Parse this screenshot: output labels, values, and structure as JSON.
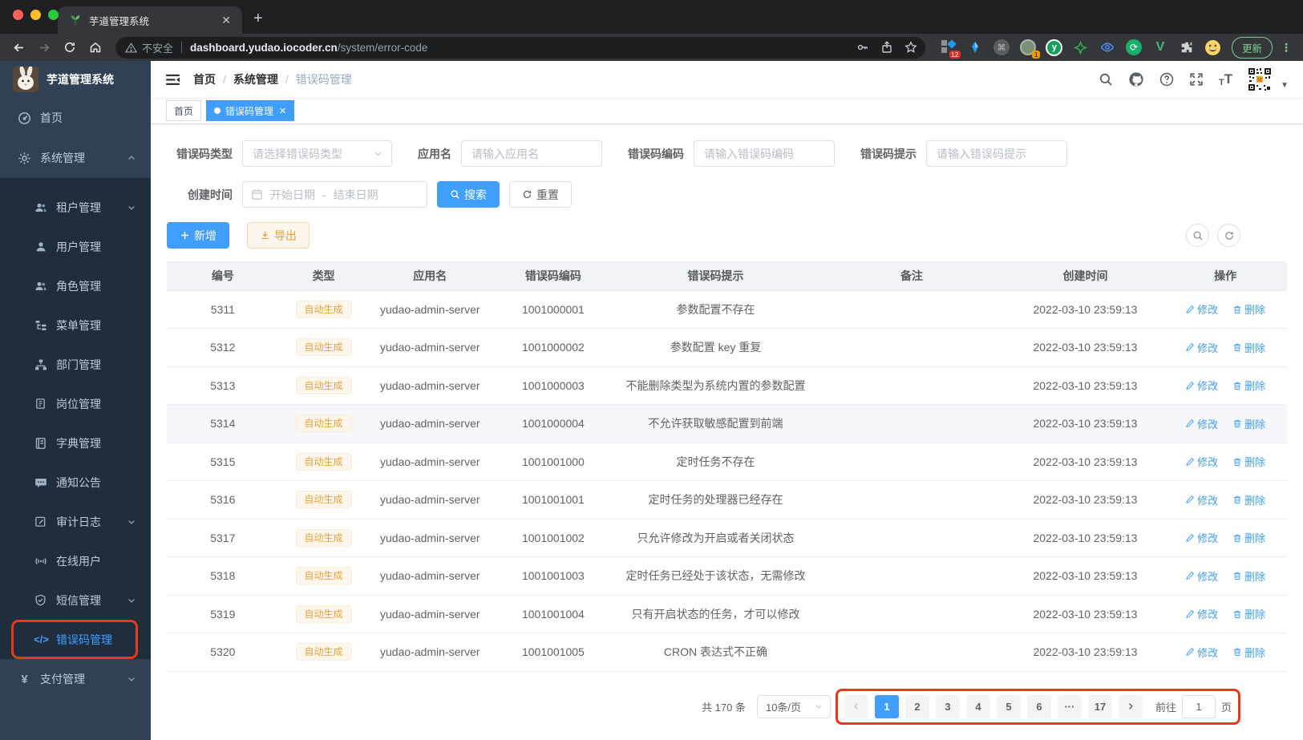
{
  "browser": {
    "tab_title": "芋道管理系统",
    "url": {
      "security_text": "不安全",
      "host": "dashboard.yudao.iocoder.cn",
      "path": "/system/error-code"
    },
    "extensions": {
      "grid_badge": "12",
      "olive_badge": "1",
      "vue_letter": "V",
      "y_letter": "y",
      "update_label": "更新"
    }
  },
  "app_title": "芋道管理系统",
  "breadcrumb": [
    "首页",
    "系统管理",
    "错误码管理"
  ],
  "tags": [
    {
      "label": "首页"
    },
    {
      "label": "错误码管理"
    }
  ],
  "sidebar": {
    "items": [
      {
        "label": "首页"
      },
      {
        "label": "系统管理"
      },
      {
        "label": "租户管理"
      },
      {
        "label": "用户管理"
      },
      {
        "label": "角色管理"
      },
      {
        "label": "菜单管理"
      },
      {
        "label": "部门管理"
      },
      {
        "label": "岗位管理"
      },
      {
        "label": "字典管理"
      },
      {
        "label": "通知公告"
      },
      {
        "label": "审计日志"
      },
      {
        "label": "在线用户"
      },
      {
        "label": "短信管理"
      },
      {
        "label": "错误码管理"
      },
      {
        "label": "支付管理"
      }
    ]
  },
  "filters": {
    "type": {
      "label": "错误码类型",
      "placeholder": "请选择错误码类型"
    },
    "app_name": {
      "label": "应用名",
      "placeholder": "请输入应用名"
    },
    "code": {
      "label": "错误码编码",
      "placeholder": "请输入错误码编码"
    },
    "message": {
      "label": "错误码提示",
      "placeholder": "请输入错误码提示"
    },
    "create_time": {
      "label": "创建时间",
      "start_placeholder": "开始日期",
      "separator": "-",
      "end_placeholder": "结束日期"
    },
    "search_label": "搜索",
    "reset_label": "重置"
  },
  "toolbar": {
    "add_label": "新增",
    "export_label": "导出"
  },
  "table": {
    "headers": [
      "编号",
      "类型",
      "应用名",
      "错误码编码",
      "错误码提示",
      "备注",
      "创建时间",
      "操作"
    ],
    "edit_label": "修改",
    "delete_label": "删除",
    "rows": [
      {
        "id": "5311",
        "type": "自动生成",
        "app": "yudao-admin-server",
        "code": "1001000001",
        "message": "参数配置不存在",
        "remark": "",
        "time": "2022-03-10 23:59:13"
      },
      {
        "id": "5312",
        "type": "自动生成",
        "app": "yudao-admin-server",
        "code": "1001000002",
        "message": "参数配置 key 重复",
        "remark": "",
        "time": "2022-03-10 23:59:13"
      },
      {
        "id": "5313",
        "type": "自动生成",
        "app": "yudao-admin-server",
        "code": "1001000003",
        "message": "不能删除类型为系统内置的参数配置",
        "remark": "",
        "time": "2022-03-10 23:59:13"
      },
      {
        "id": "5314",
        "type": "自动生成",
        "app": "yudao-admin-server",
        "code": "1001000004",
        "message": "不允许获取敏感配置到前端",
        "remark": "",
        "time": "2022-03-10 23:59:13",
        "highlight": true
      },
      {
        "id": "5315",
        "type": "自动生成",
        "app": "yudao-admin-server",
        "code": "1001001000",
        "message": "定时任务不存在",
        "remark": "",
        "time": "2022-03-10 23:59:13"
      },
      {
        "id": "5316",
        "type": "自动生成",
        "app": "yudao-admin-server",
        "code": "1001001001",
        "message": "定时任务的处理器已经存在",
        "remark": "",
        "time": "2022-03-10 23:59:13"
      },
      {
        "id": "5317",
        "type": "自动生成",
        "app": "yudao-admin-server",
        "code": "1001001002",
        "message": "只允许修改为开启或者关闭状态",
        "remark": "",
        "time": "2022-03-10 23:59:13"
      },
      {
        "id": "5318",
        "type": "自动生成",
        "app": "yudao-admin-server",
        "code": "1001001003",
        "message": "定时任务已经处于该状态，无需修改",
        "remark": "",
        "time": "2022-03-10 23:59:13"
      },
      {
        "id": "5319",
        "type": "自动生成",
        "app": "yudao-admin-server",
        "code": "1001001004",
        "message": "只有开启状态的任务，才可以修改",
        "remark": "",
        "time": "2022-03-10 23:59:13"
      },
      {
        "id": "5320",
        "type": "自动生成",
        "app": "yudao-admin-server",
        "code": "1001001005",
        "message": "CRON 表达式不正确",
        "remark": "",
        "time": "2022-03-10 23:59:13"
      }
    ]
  },
  "pagination": {
    "total_text": "共 170 条",
    "page_size_label": "10条/页",
    "pages": [
      "1",
      "2",
      "3",
      "4",
      "5",
      "6",
      "···",
      "17"
    ],
    "goto_label": "前往",
    "goto_value": "1",
    "unit_label": "页"
  }
}
